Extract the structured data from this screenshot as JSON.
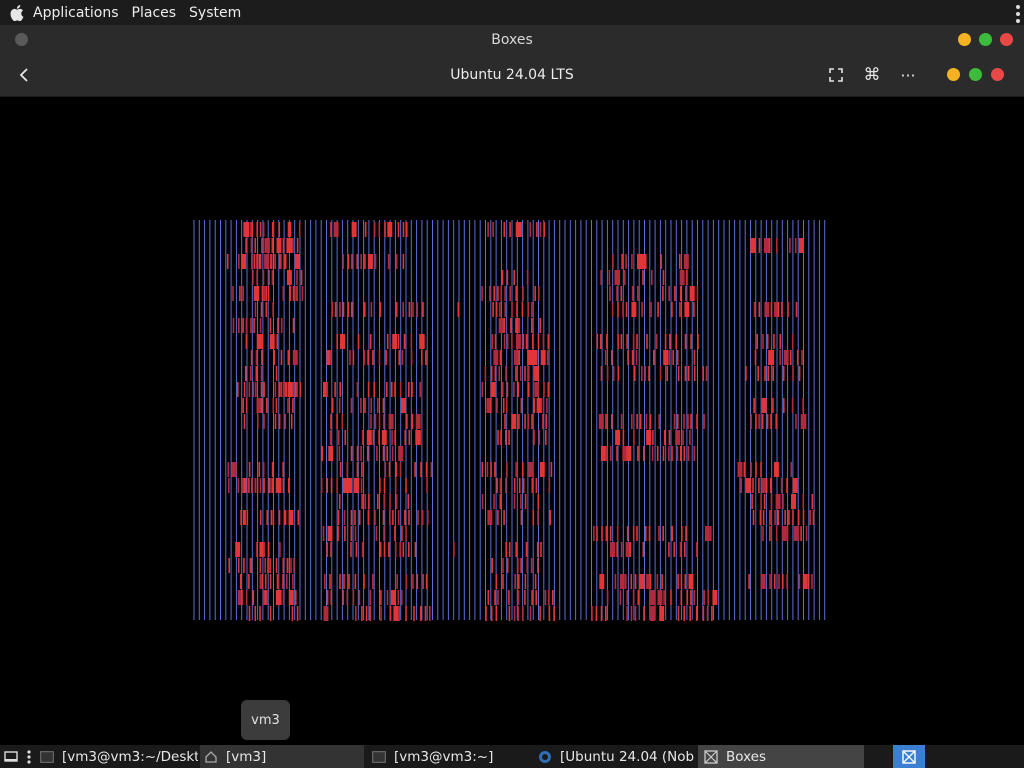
{
  "top_panel": {
    "menus": [
      "Applications",
      "Places",
      "System"
    ],
    "apple_icon": "apple-logo-icon",
    "overflow_icon": "vertical-dots-icon"
  },
  "window": {
    "app_title": "Boxes",
    "vm_title": "Ubuntu 24.04 LTS",
    "colors": {
      "minimize": "#f5b324",
      "maximize": "#3dbb3d",
      "close": "#e84848"
    }
  },
  "tooltip": {
    "text": "vm3"
  },
  "taskbar": {
    "tasks": [
      {
        "label": "[vm3@vm3:~/Deskt…",
        "icon": "terminal-icon"
      },
      {
        "label": "[vm3]",
        "icon": "home-folder-icon"
      },
      {
        "label": "[vm3@vm3:~]",
        "icon": "terminal-icon"
      },
      {
        "label": "[Ubuntu 24.04 (Nob…",
        "icon": "browser-icon"
      },
      {
        "label": "Boxes",
        "icon": "boxes-icon"
      }
    ]
  }
}
